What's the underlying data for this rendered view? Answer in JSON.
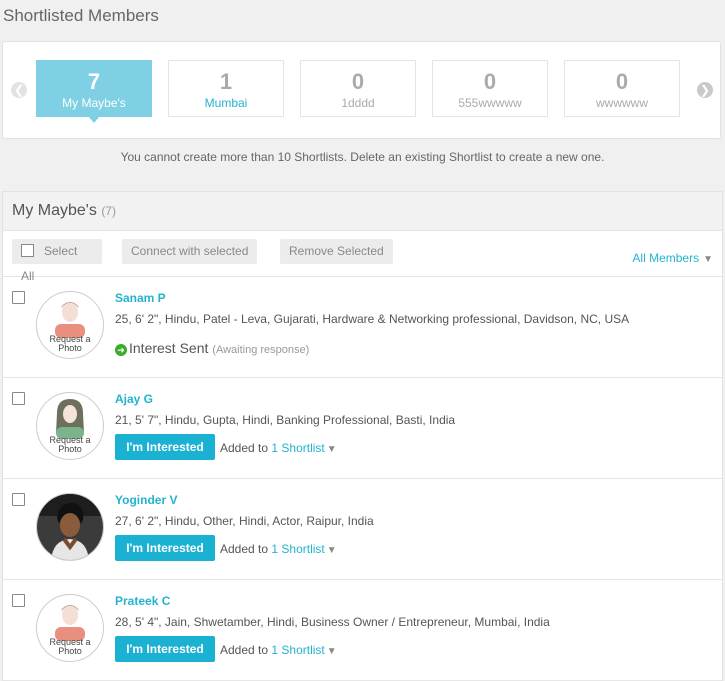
{
  "page": {
    "title": "Shortlisted Members"
  },
  "shortlists": [
    {
      "count": "7",
      "name": "My Maybe's",
      "active": true
    },
    {
      "count": "1",
      "name": "Mumbai"
    },
    {
      "count": "0",
      "name": "1dddd"
    },
    {
      "count": "0",
      "name": "555wwwww"
    },
    {
      "count": "0",
      "name": "wwwwww"
    }
  ],
  "notice": "You cannot create more than 10 Shortlists. Delete an existing Shortlist to create a new one.",
  "section": {
    "title": "My Maybe's",
    "count": "(7)"
  },
  "toolbar": {
    "select_all": "Select All",
    "connect": "Connect with selected",
    "remove": "Remove Selected",
    "filter": "All Members"
  },
  "members": [
    {
      "name": "Sanam P",
      "details": "25, 6' 2\", Hindu, Patel - Leva, Gujarati, Hardware & Networking professional, Davidson, NC, USA",
      "photo_text": [
        "Request a",
        "Photo"
      ],
      "status": "Interest Sent",
      "status_note": "(Awaiting response)"
    },
    {
      "name": "Ajay G",
      "details": "21, 5' 7\", Hindu, Gupta, Hindi, Banking Professional, Basti, India",
      "photo_text": [
        "Request a",
        "Photo"
      ],
      "button": "I'm Interested",
      "added_prefix": "Added to",
      "added_link": "1 Shortlist"
    },
    {
      "name": "Yoginder V",
      "details": "27, 6' 2\", Hindu, Other, Hindi, Actor, Raipur, India",
      "button": "I'm Interested",
      "added_prefix": "Added to",
      "added_link": "1 Shortlist"
    },
    {
      "name": "Prateek C",
      "details": "28, 5' 4\", Jain, Shwetamber, Hindi, Business Owner / Entrepreneur, Mumbai, India",
      "photo_text": [
        "Request a",
        "Photo"
      ],
      "button": "I'm Interested",
      "added_prefix": "Added to",
      "added_link": "1 Shortlist"
    }
  ],
  "colors": {
    "accent": "#1bb1d3",
    "active_card": "#7fd0e4",
    "success": "#3caa2a"
  }
}
